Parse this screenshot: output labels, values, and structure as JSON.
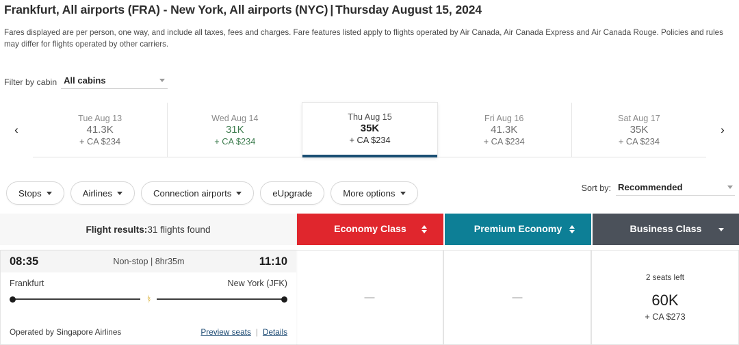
{
  "header": {
    "route_title": "Frankfurt, All airports (FRA) - New York, All airports (NYC)",
    "separator": "|",
    "date_title": "Thursday August 15, 2024",
    "disclaimer": "Fares displayed are per person, one way, and include all taxes, fees and charges. Fare features listed apply to flights operated by Air Canada, Air Canada Express and Air Canada Rouge. Policies and rules may differ for flights operated by other carriers."
  },
  "cabin_filter": {
    "label": "Filter by cabin",
    "value": "All cabins",
    "options": [
      "All cabins"
    ]
  },
  "date_strip": {
    "prev_label": "‹",
    "next_label": "›",
    "cells": [
      {
        "day": "Tue Aug 13",
        "points": "41.3K",
        "cash": "+ CA $234",
        "style": "gray",
        "selected": false
      },
      {
        "day": "Wed Aug 14",
        "points": "31K",
        "cash": "+ CA $234",
        "style": "green",
        "selected": false
      },
      {
        "day": "Thu Aug 15",
        "points": "35K",
        "cash": "+ CA $234",
        "style": "selected",
        "selected": true
      },
      {
        "day": "Fri Aug 16",
        "points": "41.3K",
        "cash": "+ CA $234",
        "style": "gray",
        "selected": false
      },
      {
        "day": "Sat Aug 17",
        "points": "35K",
        "cash": "+ CA $234",
        "style": "gray",
        "selected": false
      }
    ]
  },
  "filters": [
    {
      "label": "Stops",
      "has_caret": true
    },
    {
      "label": "Airlines",
      "has_caret": true
    },
    {
      "label": "Connection airports",
      "has_caret": true
    },
    {
      "label": "eUpgrade",
      "has_caret": false
    },
    {
      "label": "More options",
      "has_caret": true
    }
  ],
  "sort": {
    "label": "Sort by:",
    "value": "Recommended"
  },
  "results": {
    "label": "Flight results:",
    "count_text": "31 flights found"
  },
  "class_tabs": [
    {
      "label": "Economy Class",
      "color": "#e0262d",
      "control": "sort"
    },
    {
      "label": "Premium Economy",
      "color": "#0d7f96",
      "control": "sort"
    },
    {
      "label": "Business Class",
      "color": "#4b515a",
      "control": "caret"
    }
  ],
  "flight": {
    "depart_time": "08:35",
    "stops_duration": "Non-stop | 8hr35m",
    "arrive_time": "11:10",
    "origin_city": "Frankfurt",
    "destination_city": "New York (JFK)",
    "operated_by": "Operated by Singapore Airlines",
    "preview_seats_link": "Preview seats",
    "link_divider": "|",
    "details_link": "Details",
    "fares": [
      {
        "cabin": "Economy Class",
        "available": false,
        "dash": "—"
      },
      {
        "cabin": "Premium Economy",
        "available": false,
        "dash": "—"
      },
      {
        "cabin": "Business Class",
        "available": true,
        "seats_left": "2 seats left",
        "points": "60K",
        "cash": "+ CA $273"
      }
    ]
  },
  "colors": {
    "economy_red": "#e0262d",
    "premium_teal": "#0d7f96",
    "business_gray": "#4b515a",
    "selected_underline": "#1a4f73",
    "green_price": "#3e7d4f",
    "link_blue": "#1c4a73"
  }
}
